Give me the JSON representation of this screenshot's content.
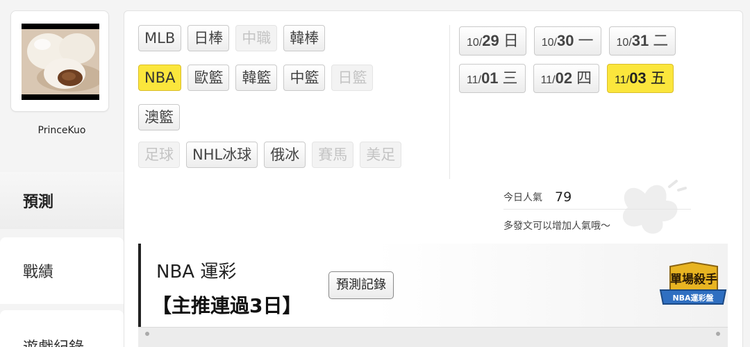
{
  "user": {
    "name": "PrinceKuo"
  },
  "nav": {
    "predict": "預測",
    "record": "戰績",
    "games": "遊戲紀錄"
  },
  "sports": {
    "row1": [
      {
        "label": "MLB",
        "state": "normal"
      },
      {
        "label": "日棒",
        "state": "normal"
      },
      {
        "label": "中職",
        "state": "disabled"
      },
      {
        "label": "韓棒",
        "state": "normal"
      }
    ],
    "row2": [
      {
        "label": "NBA",
        "state": "active"
      },
      {
        "label": "歐籃",
        "state": "normal"
      },
      {
        "label": "韓籃",
        "state": "normal"
      },
      {
        "label": "中籃",
        "state": "normal"
      },
      {
        "label": "日籃",
        "state": "disabled"
      }
    ],
    "row3": [
      {
        "label": "澳籃",
        "state": "normal"
      }
    ],
    "row4": [
      {
        "label": "足球",
        "state": "disabled"
      },
      {
        "label": "NHL冰球",
        "state": "normal"
      },
      {
        "label": "俄冰",
        "state": "normal"
      },
      {
        "label": "賽馬",
        "state": "disabled"
      },
      {
        "label": "美足",
        "state": "disabled"
      }
    ]
  },
  "dates": {
    "row1": [
      {
        "month": "10/",
        "day": "29",
        "weekday": "日",
        "active": false
      },
      {
        "month": "10/",
        "day": "30",
        "weekday": "一",
        "active": false
      },
      {
        "month": "10/",
        "day": "31",
        "weekday": "二",
        "active": false
      }
    ],
    "row2": [
      {
        "month": "11/",
        "day": "01",
        "weekday": "三",
        "active": false
      },
      {
        "month": "11/",
        "day": "02",
        "weekday": "四",
        "active": false
      },
      {
        "month": "11/",
        "day": "03",
        "weekday": "五",
        "active": true
      }
    ]
  },
  "popularity": {
    "label": "今日人氣",
    "value": "79",
    "hint": "多發文可以增加人氣哦～"
  },
  "league": {
    "title": "NBA 運彩",
    "subtitle": "【主推連過3日】",
    "record_button": "預測記錄",
    "badge_main": "單場殺手",
    "badge_sub": "NBA運彩盤"
  },
  "colors": {
    "active_chip": "#fbe63c",
    "badge_blue": "#2f6fc1",
    "badge_gold": "#e8b422"
  }
}
